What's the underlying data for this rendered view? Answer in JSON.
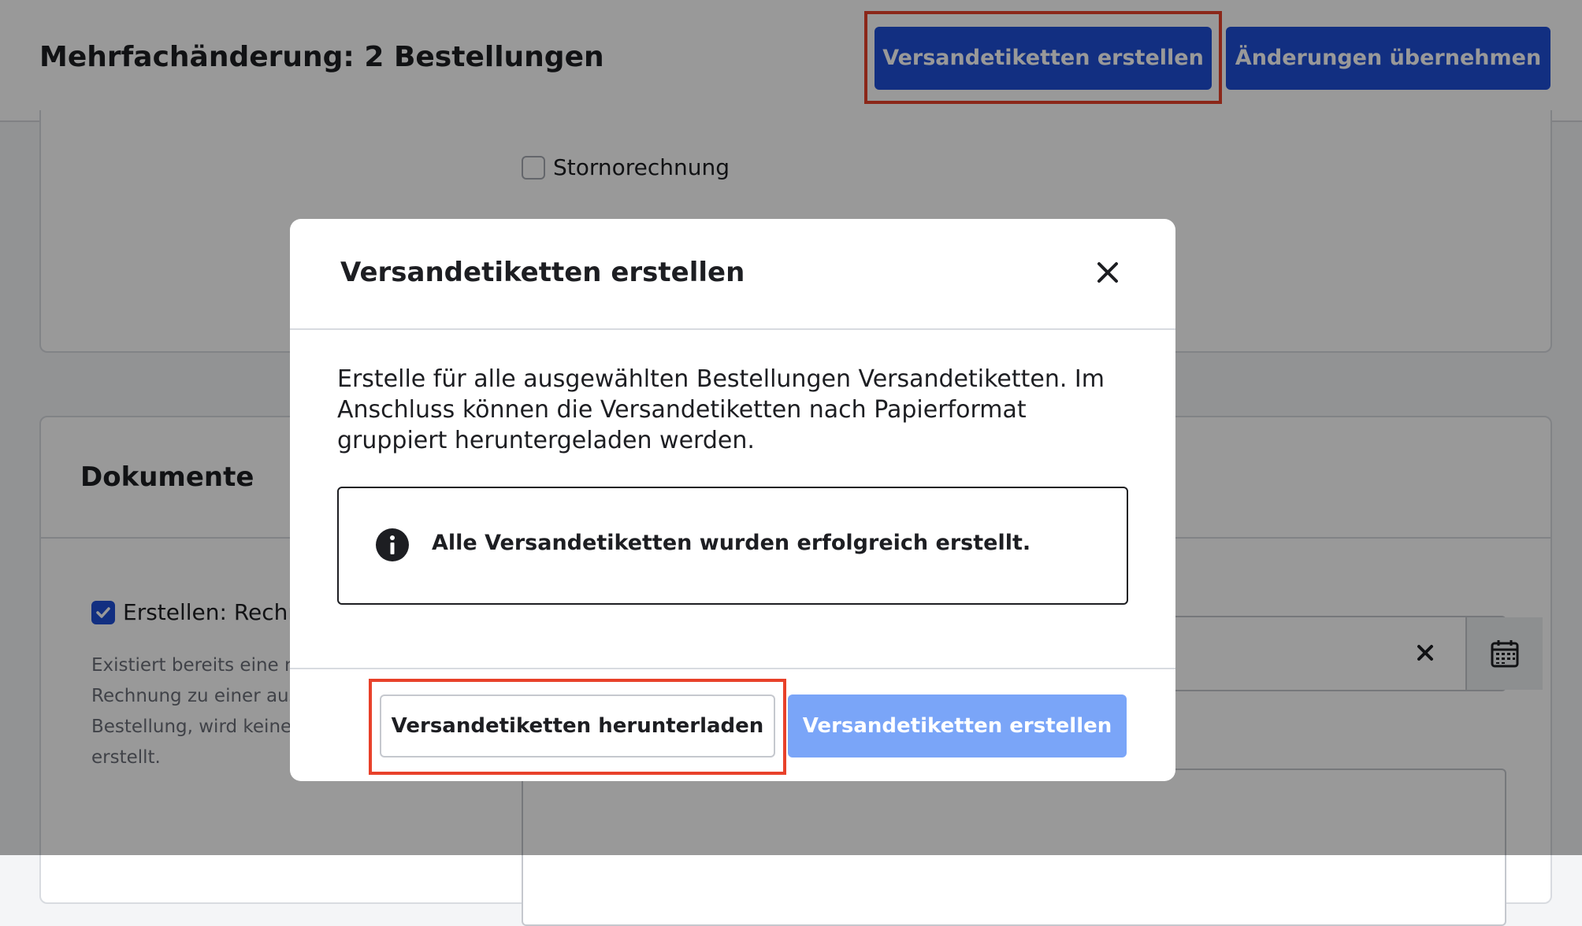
{
  "header": {
    "title": "Mehrfachänderung: 2 Bestellungen",
    "create_labels_button": "Versandetiketten erstellen",
    "apply_changes_button": "Änderungen übernehmen"
  },
  "background": {
    "storno_label": "Stornorechnung",
    "documents_title": "Dokumente",
    "create_invoice_label": "Erstellen: Rechn",
    "invoice_help_lines": [
      "Existiert bereits eine n",
      "Rechnung zu einer aus",
      "Bestellung, wird keine",
      "erstellt."
    ]
  },
  "modal": {
    "title": "Versandetiketten erstellen",
    "description": "Erstelle für alle ausgewählten Bestellungen Versandetiketten. Im Anschluss können die Versandetiketten nach Papierformat gruppiert heruntergeladen werden.",
    "notice": "Alle Versandetiketten wurden erfolgreich erstellt.",
    "download_button": "Versandetiketten herunterladen",
    "create_button": "Versandetiketten erstellen"
  },
  "colors": {
    "primary": "#1f4fd8",
    "primary_disabled": "#7aa5f8",
    "highlight": "#e8412a"
  }
}
